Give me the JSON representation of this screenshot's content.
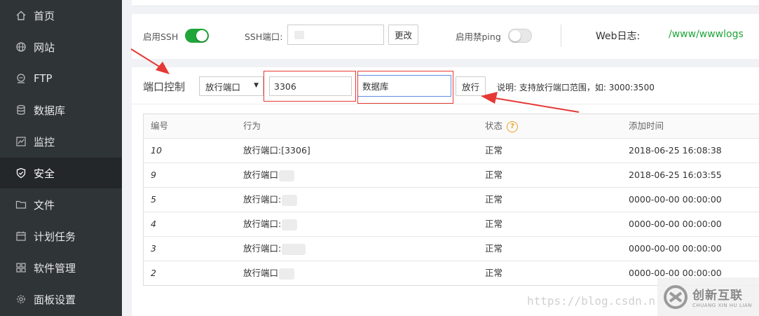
{
  "sidebar": {
    "items": [
      {
        "label": "首页",
        "icon": "home-icon"
      },
      {
        "label": "网站",
        "icon": "globe-icon"
      },
      {
        "label": "FTP",
        "icon": "ftp-icon"
      },
      {
        "label": "数据库",
        "icon": "database-icon"
      },
      {
        "label": "监控",
        "icon": "monitor-icon"
      },
      {
        "label": "安全",
        "icon": "shield-icon",
        "active": true
      },
      {
        "label": "文件",
        "icon": "folder-icon"
      },
      {
        "label": "计划任务",
        "icon": "calendar-icon"
      },
      {
        "label": "软件管理",
        "icon": "apps-icon"
      },
      {
        "label": "面板设置",
        "icon": "gear-icon"
      }
    ]
  },
  "ssh": {
    "enable_label": "启用SSH",
    "enable_on": true,
    "port_label": "SSH端口:",
    "port_value": "",
    "change_button": "更改",
    "ping_label": "启用禁ping",
    "ping_on": false,
    "weblog_label": "Web日志:",
    "weblog_path": "/www/wwwlogs"
  },
  "port_control": {
    "title": "端口控制",
    "select_value": "放行端口",
    "port_input": "3306",
    "desc_input": "数据库",
    "submit_button": "放行",
    "hint": "说明: 支持放行端口范围，如: 3000:3500"
  },
  "table": {
    "headers": [
      "编号",
      "行为",
      "状态",
      "添加时间"
    ],
    "rows": [
      {
        "id": "10",
        "action": "放行端口:[3306]",
        "status": "正常",
        "time": "2018-06-25 16:08:38"
      },
      {
        "id": "9",
        "action": "放行端口",
        "status": "正常",
        "time": "2018-06-25 16:03:55"
      },
      {
        "id": "5",
        "action": "放行端口:",
        "status": "正常",
        "time": "0000-00-00 00:00:00"
      },
      {
        "id": "4",
        "action": "放行端口:",
        "status": "正常",
        "time": "0000-00-00 00:00:00"
      },
      {
        "id": "3",
        "action": "放行端口:",
        "status": "正常",
        "time": "0000-00-00 00:00:00"
      },
      {
        "id": "2",
        "action": "放行端口",
        "status": "正常",
        "time": "0000-00-00 00:00:00"
      }
    ]
  },
  "watermark": "https://blog.csdn.n",
  "logo": {
    "cn": "创新互联",
    "en": "CHUANG XIN HU LIAN"
  },
  "colors": {
    "accent": "#20a53a",
    "sidebar": "#2f3437",
    "annotation": "#e53935",
    "link": "#20a53a"
  }
}
